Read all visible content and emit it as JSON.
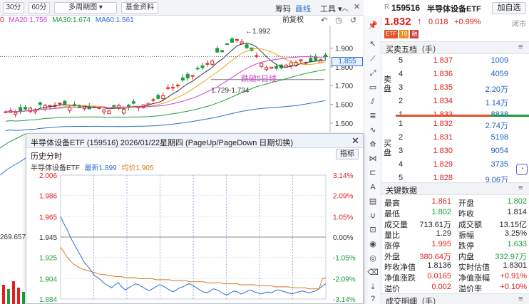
{
  "toolbar": {
    "period_30": "30分",
    "period_60": "60分",
    "multi_period": "多周期图",
    "fund_info": "基金资料",
    "chips": "筹码",
    "draw": "画线",
    "tools": "工具"
  },
  "ma": {
    "ma_cut": "0",
    "ma20": "MA20:1.756",
    "ma30": "MA30:1.674",
    "ma60": "MA60:1.561",
    "adjust": "前复权"
  },
  "kchart": {
    "high_label": "1.992",
    "low_label": "1.729-1.734",
    "annotation": "跌破5日线",
    "price_tag": "1.855",
    "left_value": "269.657",
    "yticks": [
      "1.900",
      "1.800",
      "1.700",
      "1.600",
      "1.500"
    ],
    "colors": {
      "up": "#e02020",
      "down": "#1a9e3a",
      "ma5": "#333333",
      "ma10": "#e8a317",
      "ma20": "#d040d0",
      "ma30": "#1a9e3a",
      "ma60": "#2a6fd6"
    }
  },
  "popup": {
    "title": "半导体设备ETF  (159516)   2026/01/22星期四   (PageUp/PageDown 日期切换)",
    "subtitle": "历史分时",
    "indicator_button": "指标",
    "legend_name": "半导体设备ETF",
    "legend_latest": "最新1.899",
    "legend_avg": "均价1.905",
    "chart_data": {
      "type": "line",
      "y_ticks_left": [
        "2.006",
        "1.986",
        "1.965",
        "1.945",
        "1.925",
        "1.904",
        "1.884"
      ],
      "y_ticks_right": [
        "3.14%",
        "2.09%",
        "1.05%",
        "0.00%",
        "-1.05%",
        "-2.09%",
        "-3.14%"
      ],
      "ylim": [
        1.884,
        2.006
      ],
      "prev_close": 1.945,
      "series": [
        {
          "name": "最新",
          "color": "#2a6fd6",
          "values": [
            1.965,
            1.958,
            1.952,
            1.944,
            1.938,
            1.932,
            1.926,
            1.92,
            1.916,
            1.912,
            1.907,
            1.905,
            1.902,
            1.899,
            1.897,
            1.895,
            1.898,
            1.9,
            1.896,
            1.893,
            1.895,
            1.897,
            1.899,
            1.898,
            1.896,
            1.894,
            1.892,
            1.894,
            1.896,
            1.898,
            1.897,
            1.895,
            1.893,
            1.891,
            1.893,
            1.895,
            1.896,
            1.898,
            1.899,
            1.897,
            1.895,
            1.893,
            1.891,
            1.89,
            1.892,
            1.894,
            1.893,
            1.891,
            1.889,
            1.888,
            1.89,
            1.892,
            1.891,
            1.889,
            1.89,
            1.892,
            1.893,
            1.891,
            1.89,
            1.889,
            1.89,
            1.891,
            1.89,
            1.892,
            1.893,
            1.892,
            1.891,
            1.89,
            1.889,
            1.89,
            1.891,
            1.892,
            1.891,
            1.89,
            1.891,
            1.892,
            1.894,
            1.897,
            1.899
          ]
        },
        {
          "name": "均价",
          "color": "#d47a1a",
          "values": [
            1.935,
            1.93,
            1.925,
            1.921,
            1.918,
            1.916,
            1.914,
            1.913,
            1.912,
            1.911,
            1.91,
            1.909,
            1.908,
            1.908,
            1.907,
            1.907,
            1.906,
            1.906,
            1.906,
            1.905,
            1.905,
            1.905,
            1.905,
            1.904,
            1.904,
            1.904,
            1.904,
            1.904,
            1.903,
            1.903,
            1.903,
            1.903,
            1.903,
            1.902,
            1.902,
            1.902,
            1.902,
            1.902,
            1.901,
            1.901,
            1.901,
            1.901,
            1.901,
            1.9,
            1.9,
            1.9,
            1.9,
            1.9,
            1.899,
            1.899,
            1.899,
            1.899,
            1.899,
            1.898,
            1.898,
            1.898,
            1.898,
            1.898,
            1.897,
            1.897,
            1.897,
            1.897,
            1.897,
            1.896,
            1.896,
            1.896,
            1.896,
            1.896,
            1.895,
            1.895,
            1.895,
            1.895,
            1.895,
            1.894,
            1.894,
            1.894,
            1.894,
            1.904,
            1.905
          ]
        }
      ]
    }
  },
  "panel": {
    "prefix": "R",
    "code": "159516",
    "name": "半导体设备ETF",
    "add_watch": "加自选",
    "price": "1.832",
    "change": "0.018",
    "change_pct": "+0.99%",
    "status": "闭市",
    "badges": [
      "ETF",
      "T0",
      "融"
    ],
    "orderbook_title": "买卖五档（手）",
    "sell_label": "卖盘",
    "buy_label": "买盘",
    "sell": [
      {
        "level": "5",
        "price": "1.837",
        "vol": "1009"
      },
      {
        "level": "4",
        "price": "1.836",
        "vol": "4059"
      },
      {
        "level": "3",
        "price": "1.835",
        "vol": "2.20万"
      },
      {
        "level": "2",
        "price": "1.834",
        "vol": "1.14万"
      },
      {
        "level": "1",
        "price": "1.833",
        "vol": "8838"
      }
    ],
    "buy": [
      {
        "level": "1",
        "price": "1.832",
        "vol": "2.74万"
      },
      {
        "level": "2",
        "price": "1.831",
        "vol": "5198"
      },
      {
        "level": "3",
        "price": "1.830",
        "vol": "9054"
      },
      {
        "level": "4",
        "price": "1.829",
        "vol": "3735"
      },
      {
        "level": "5",
        "price": "1.828",
        "vol": "9.06万"
      }
    ],
    "key_title": "关键数据",
    "key": [
      {
        "l1": "最高",
        "v1": "1.861",
        "c1": "red",
        "l2": "开盘",
        "v2": "1.802",
        "c2": "green"
      },
      {
        "l1": "最低",
        "v1": "1.802",
        "c1": "green",
        "l2": "昨收",
        "v2": "1.814",
        "c2": "dark"
      },
      {
        "l1": "成交量",
        "v1": "713.61万",
        "c1": "dark",
        "l2": "成交额",
        "v2": "13.15亿",
        "c2": "dark"
      },
      {
        "l1": "量比",
        "v1": "1.29",
        "c1": "dark",
        "l2": "振幅",
        "v2": "3.25%",
        "c2": "dark"
      },
      {
        "l1": "涨停",
        "v1": "1.995",
        "c1": "red",
        "l2": "跌停",
        "v2": "1.633",
        "c2": "green"
      },
      {
        "l1": "外盘",
        "v1": "380.64万",
        "c1": "red",
        "l2": "内盘",
        "v2": "332.97万",
        "c2": "green"
      },
      {
        "l1": "昨收净值",
        "v1": "1.8136",
        "c1": "dark",
        "l2": "实时估值",
        "v2": "1.8301",
        "c2": "dark"
      },
      {
        "l1": "净值涨跌",
        "v1": "0.0165",
        "c1": "red",
        "l2": "净值涨幅",
        "v2": "+0.91%",
        "c2": "red"
      },
      {
        "l1": "溢价",
        "v1": "0.002",
        "c1": "red",
        "l2": "溢价率",
        "v2": "+0.10%",
        "c2": "red"
      }
    ],
    "trades_title": "成交明细（手）"
  }
}
